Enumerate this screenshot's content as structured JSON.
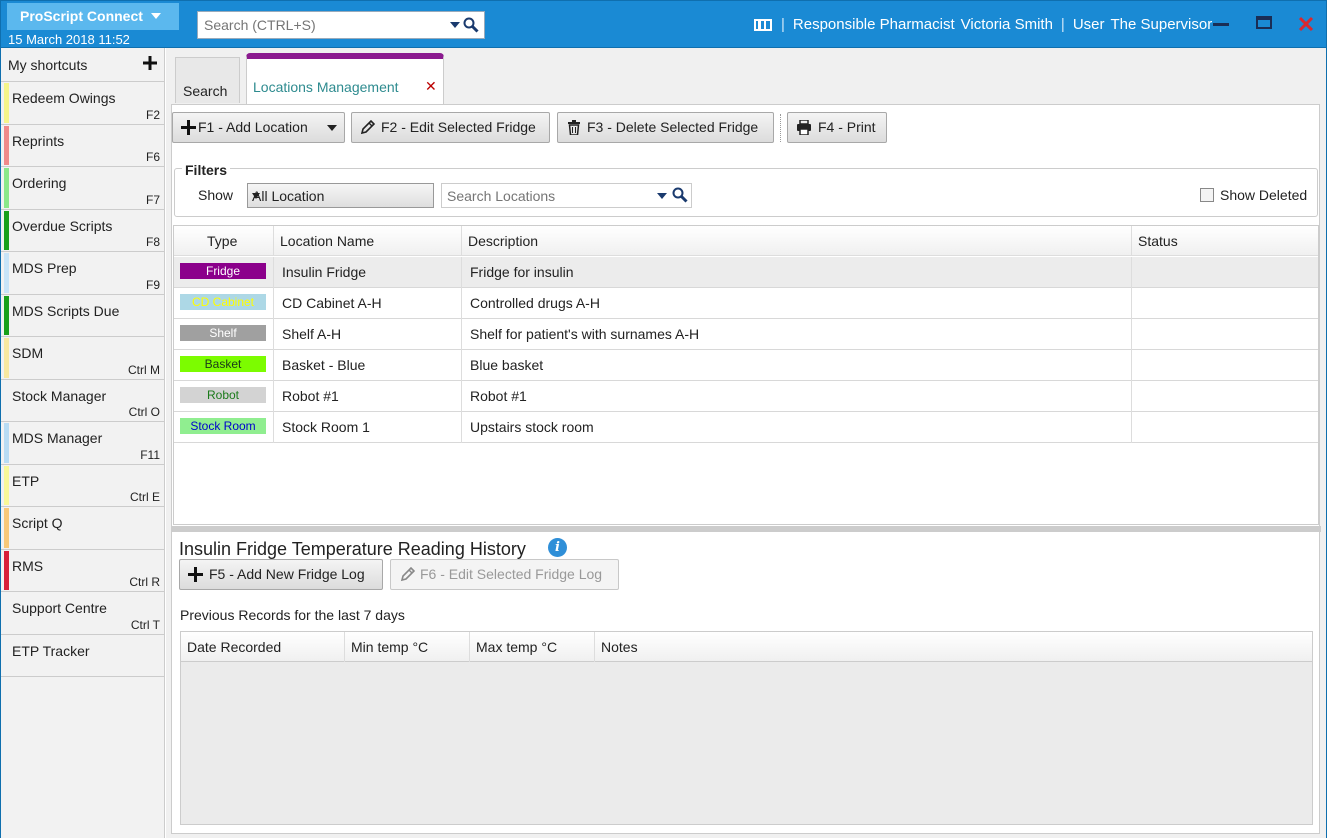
{
  "titlebar": {
    "app_name": "ProScript Connect",
    "datetime": "15 March 2018 11:52",
    "search_placeholder": "Search (CTRL+S)",
    "pharmacist_label": "Responsible Pharmacist",
    "pharmacist_name": "Victoria Smith",
    "user_label": "User",
    "user_name": "The Supervisor"
  },
  "sidebar": {
    "header": "My shortcuts",
    "items": [
      {
        "label": "Redeem Owings",
        "key": "F2",
        "color": "#f5f58a"
      },
      {
        "label": "Reprints",
        "key": "F6",
        "color": "#f08a8a"
      },
      {
        "label": "Ordering",
        "key": "F7",
        "color": "#8ae88a"
      },
      {
        "label": "Overdue Scripts",
        "key": "F8",
        "color": "#1aa01a"
      },
      {
        "label": "MDS Prep",
        "key": "F9",
        "color": "#c8e4f8"
      },
      {
        "label": "MDS Scripts Due",
        "key": "",
        "color": "#1aa01a"
      },
      {
        "label": "SDM",
        "key": "Ctrl M",
        "color": "#f8e8a0"
      },
      {
        "label": "Stock Manager",
        "key": "Ctrl O",
        "color": ""
      },
      {
        "label": "MDS Manager",
        "key": "F11",
        "color": "#b8dcf4"
      },
      {
        "label": "ETP",
        "key": "Ctrl E",
        "color": "#f8f898"
      },
      {
        "label": "Script Q",
        "key": "",
        "color": "#f8c878"
      },
      {
        "label": "RMS",
        "key": "Ctrl R",
        "color": "#d8203a"
      },
      {
        "label": "Support Centre",
        "key": "Ctrl T",
        "color": ""
      },
      {
        "label": "ETP Tracker",
        "key": "",
        "color": ""
      }
    ]
  },
  "tabs": {
    "search": "Search",
    "locations": "Locations Management"
  },
  "toolbar": {
    "add": "F1 - Add Location",
    "edit": "F2 - Edit Selected Fridge",
    "delete": "F3 - Delete Selected Fridge",
    "print": "F4 - Print"
  },
  "filters": {
    "title": "Filters",
    "show_label": "Show",
    "show_value": "All Location",
    "search_placeholder": "Search Locations",
    "show_deleted": "Show Deleted"
  },
  "locations": {
    "columns": [
      "Type",
      "Location Name",
      "Description",
      "Status"
    ],
    "rows": [
      {
        "type": "Fridge",
        "type_bg": "#8b008b",
        "type_fg": "#ffffff",
        "name": "Insulin Fridge",
        "desc": "Fridge for insulin",
        "status": ""
      },
      {
        "type": "CD Cabinet",
        "type_bg": "#add8e6",
        "type_fg": "#ffff00",
        "name": "CD Cabinet A-H",
        "desc": "Controlled drugs A-H",
        "status": ""
      },
      {
        "type": "Shelf",
        "type_bg": "#a0a0a0",
        "type_fg": "#ffffff",
        "name": "Shelf A-H",
        "desc": "Shelf for patient's with surnames A-H",
        "status": ""
      },
      {
        "type": "Basket",
        "type_bg": "#7cfc00",
        "type_fg": "#1a3a1a",
        "name": "Basket - Blue",
        "desc": "Blue basket",
        "status": ""
      },
      {
        "type": "Robot",
        "type_bg": "#d3d3d3",
        "type_fg": "#1a7a1a",
        "name": "Robot #1",
        "desc": "Robot #1",
        "status": ""
      },
      {
        "type": "Stock Room",
        "type_bg": "#90ee90",
        "type_fg": "#0000cd",
        "name": "Stock Room 1",
        "desc": "Upstairs stock room",
        "status": ""
      }
    ]
  },
  "history": {
    "title": "Insulin Fridge Temperature Reading History",
    "add_log": "F5 - Add New Fridge Log",
    "edit_log": "F6 - Edit Selected Fridge Log",
    "records_note": "Previous Records for the last 7 days",
    "columns": [
      "Date Recorded",
      "Min temp °C",
      "Max temp °C",
      "Notes"
    ]
  }
}
